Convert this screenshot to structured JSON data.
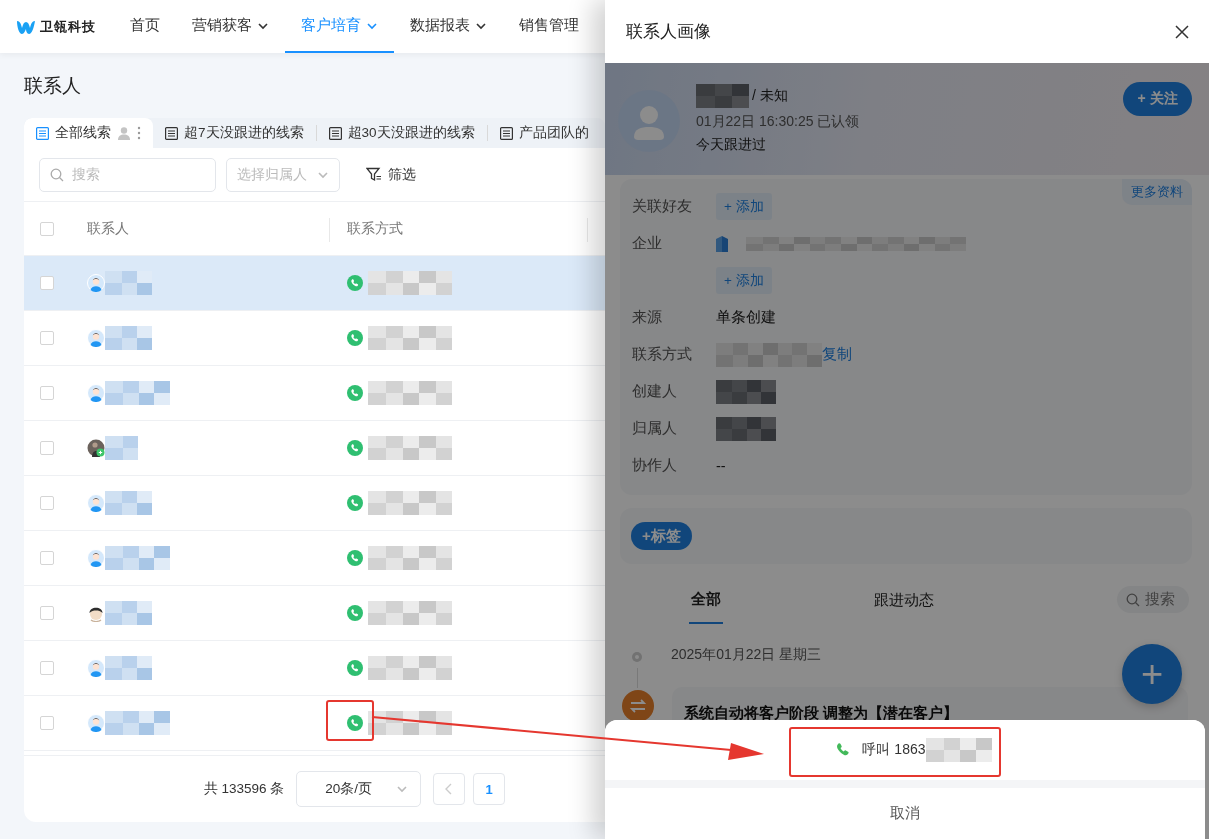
{
  "nav": {
    "logo": "卫瓴科技",
    "items": [
      {
        "label": "首页",
        "selected": false,
        "dropdown": false
      },
      {
        "label": "营销获客",
        "selected": false,
        "dropdown": true
      },
      {
        "label": "客户培育",
        "selected": true,
        "dropdown": true
      },
      {
        "label": "数据报表",
        "selected": false,
        "dropdown": true
      },
      {
        "label": "销售管理",
        "selected": false,
        "dropdown": false
      }
    ]
  },
  "page_title": "联系人",
  "view_tabs": [
    {
      "label": "全部线索",
      "selected": true
    },
    {
      "label": "超7天没跟进的线索",
      "selected": false
    },
    {
      "label": "超30天没跟进的线索",
      "selected": false
    },
    {
      "label": "产品团队的",
      "selected": false
    }
  ],
  "search": {
    "placeholder": "搜索"
  },
  "owner_select": {
    "placeholder": "选择归属人"
  },
  "filter_button": "筛选",
  "table": {
    "all_checked": false,
    "columns": [
      "联系人",
      "联系方式"
    ],
    "rows": [
      {
        "kind": "default",
        "hovered": true,
        "checked": false
      },
      {
        "kind": "default",
        "hovered": false,
        "checked": false
      },
      {
        "kind": "default",
        "hovered": false,
        "checked": false
      },
      {
        "kind": "photo",
        "hovered": false,
        "checked": false
      },
      {
        "kind": "default",
        "hovered": false,
        "checked": false
      },
      {
        "kind": "default",
        "hovered": false,
        "checked": false
      },
      {
        "kind": "cartoon",
        "hovered": false,
        "checked": false
      },
      {
        "kind": "default",
        "hovered": false,
        "checked": false
      },
      {
        "kind": "default",
        "hovered": false,
        "checked": false
      }
    ]
  },
  "pagination": {
    "total": "共 133596 条",
    "page_size": "20条/页",
    "pages": [
      {
        "label": "1",
        "selected": true
      }
    ]
  },
  "drawer": {
    "title": "联系人画像",
    "profile": {
      "gender": "/ 未知",
      "claimed": "01月22日 16:30:25 已认领",
      "followup": "今天跟进过",
      "follow_button": "+ 关注"
    },
    "more_link": "更多资料",
    "fields": [
      {
        "label": "关联好友",
        "kind": "add",
        "action": "+ 添加"
      },
      {
        "label": "企业",
        "kind": "company",
        "action": "+ 添加"
      },
      {
        "label": "来源",
        "kind": "text",
        "value": "单条创建"
      },
      {
        "label": "联系方式",
        "kind": "masked",
        "action": "复制"
      },
      {
        "label": "创建人",
        "kind": "masked"
      },
      {
        "label": "归属人",
        "kind": "masked"
      },
      {
        "label": "协作人",
        "kind": "text",
        "value": "--"
      }
    ],
    "tag_button": "+标签",
    "tabs": [
      {
        "label": "全部",
        "selected": true
      },
      {
        "label": "跟进动态",
        "selected": false
      }
    ],
    "tab_search": {
      "placeholder": "搜索"
    },
    "timeline": {
      "date": "2025年01月22日 星期三",
      "entry": "系统自动将客户阶段 调整为【潜在客户】"
    },
    "fab": "+"
  },
  "action_sheet": {
    "call": "呼叫 1863",
    "cancel": "取消"
  }
}
